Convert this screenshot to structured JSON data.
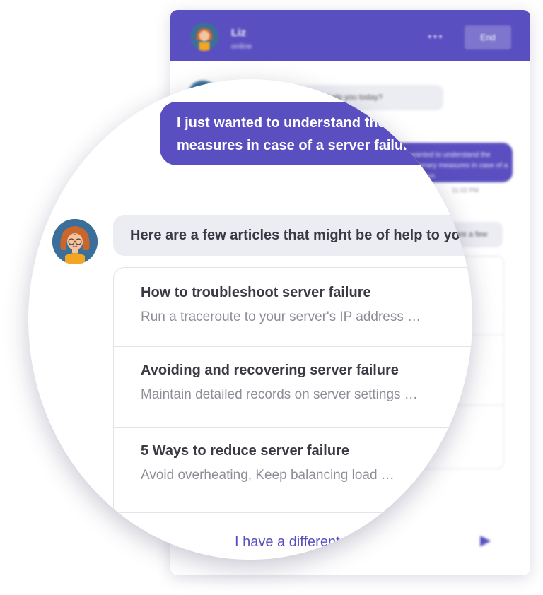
{
  "window": {
    "agent_name": "Liz",
    "agent_status": "online",
    "menu_dots": "•••",
    "end_button_label": "End",
    "greeting": "Hey! I am Liz! How can I help you today?",
    "user_message_preview": "I just wanted to understand the precautionary measures in case of a server failure.",
    "timestamp": "11:02 PM",
    "reply_preview": "Here are a few articles that might be of help to you",
    "send_icon": "send-icon"
  },
  "conversation": {
    "user_message_line1": "I just wanted to understand the precautionary",
    "user_message_line2": "measures in case of a server failure.",
    "bot_reply": "Here are a few articles that might be of help to you",
    "articles": [
      {
        "title": "How to troubleshoot server failure",
        "description": "Run a traceroute to your server's IP address …"
      },
      {
        "title": "Avoiding and recovering server failure",
        "description": "Maintain detailed records on server settings …"
      },
      {
        "title": "5 Ways to reduce server failure",
        "description": "Avoid overheating, Keep balancing load …"
      }
    ],
    "different_question_label": "I have a different question"
  },
  "colors": {
    "brand": "#5a4fc0",
    "bubble_gray": "#ececf3",
    "text_dark": "#3a3a44",
    "text_muted": "#8e8e98"
  }
}
